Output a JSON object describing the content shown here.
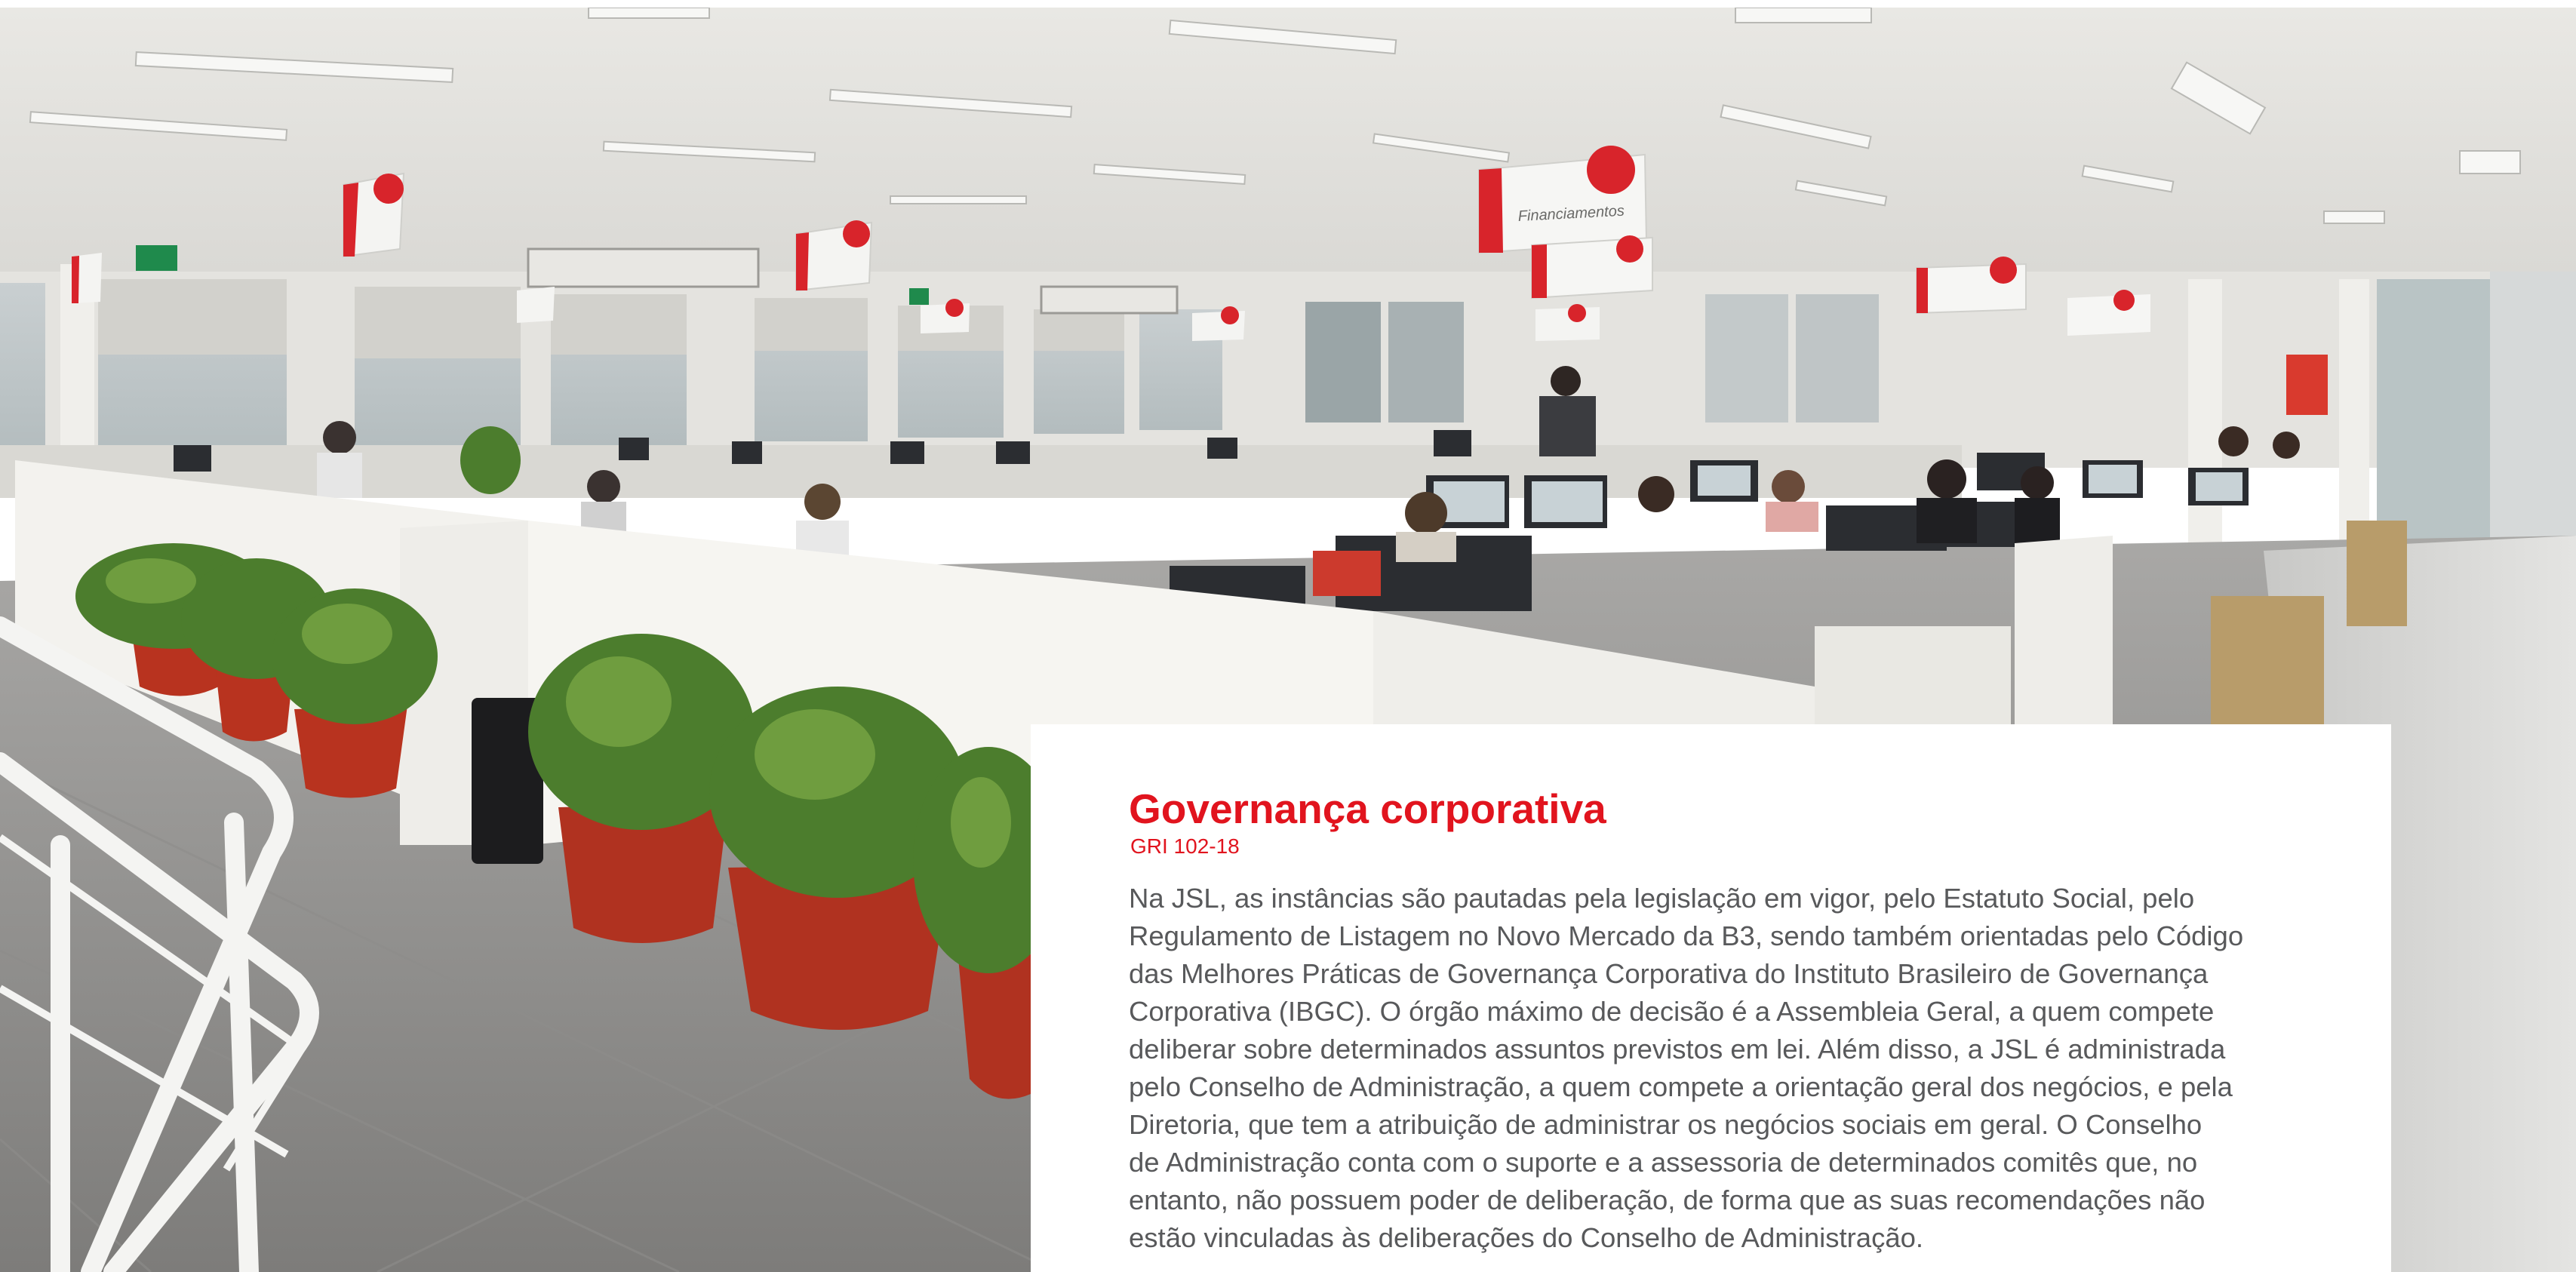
{
  "photo": {
    "signs": [
      "Financiamentos"
    ]
  },
  "section": {
    "title": "Governança corporativa",
    "reference": "GRI 102-18",
    "body_lines": [
      "Na JSL, as instâncias são pautadas pela legislação em vigor, pelo Estatuto Social, pelo",
      "Regulamento de Listagem no Novo Mercado da B3, sendo também orientadas pelo Código",
      "das Melhores Práticas de Governança Corporativa do Instituto Brasileiro de Governança",
      "Corporativa (IBGC). O órgão máximo de decisão é a Assembleia Geral, a quem compete",
      "deliberar sobre determinados assuntos previstos em lei. Além disso, a JSL é administrada",
      "pelo Conselho de Administração, a quem compete a orientação geral dos negócios, e pela",
      "Diretoria, que tem a atribuição de administrar os negócios sociais em geral. O Conselho",
      "de Administração conta com o suporte e a assessoria de determinados comitês que, no",
      "entanto, não possuem poder de deliberação, de forma que as suas recomendações não",
      "estão vinculadas às deliberações do Conselho de Administração."
    ]
  },
  "colors": {
    "accent": "#e1141e",
    "body_text": "#58595b",
    "background": "#ffffff"
  }
}
